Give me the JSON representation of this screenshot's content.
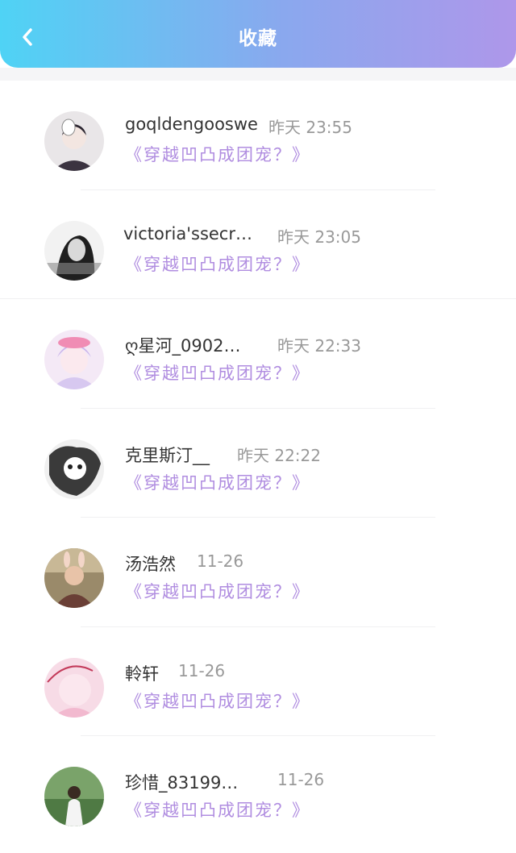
{
  "header": {
    "title": "收藏",
    "back_icon": "chevron-left-icon",
    "gradient_start": "#4fd3f5",
    "gradient_end": "#ae97ea"
  },
  "colors": {
    "book_title": "#b08de0",
    "time": "#999999",
    "name": "#333333"
  },
  "favorites": [
    {
      "name": "goqldengooswe",
      "time": "昨天 23:55",
      "book": "《穿越凹凸成团宠？》"
    },
    {
      "name": "victoria'ssecr…",
      "time": "昨天 23:05",
      "book": "《穿越凹凸成团宠？》"
    },
    {
      "name": "ღ星河_0902…",
      "time": "昨天 22:33",
      "book": "《穿越凹凸成团宠？》"
    },
    {
      "name": "克里斯汀__",
      "time": "昨天 22:22",
      "book": "《穿越凹凸成团宠？》"
    },
    {
      "name": "汤浩然",
      "time": "11-26",
      "book": "《穿越凹凸成团宠？》"
    },
    {
      "name": "軨轩",
      "time": "11-26",
      "book": "《穿越凹凸成团宠？》"
    },
    {
      "name": "珍惜_83199…",
      "time": "11-26",
      "book": "《穿越凹凸成团宠？》"
    }
  ]
}
